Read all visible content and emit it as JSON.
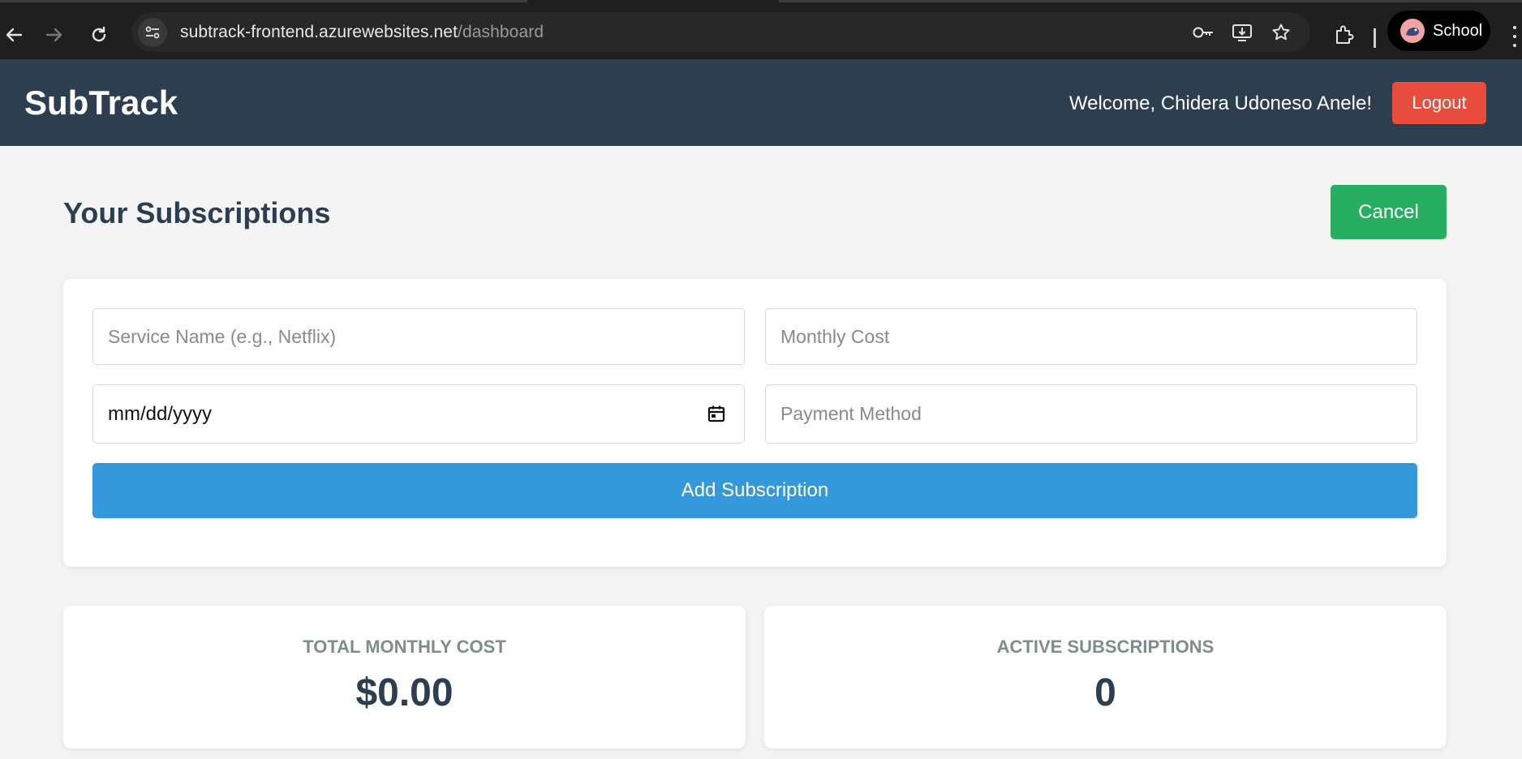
{
  "browser": {
    "url_host": "subtrack-frontend.azurewebsites.net",
    "url_path": "/dashboard",
    "profile_label": "School",
    "icons": [
      "back-icon",
      "forward-icon",
      "reload-icon",
      "site-info-icon",
      "password-key-icon",
      "install-app-icon",
      "bookmark-star-icon",
      "extensions-icon",
      "menu-icon"
    ]
  },
  "header": {
    "brand": "SubTrack",
    "welcome": "Welcome, Chidera Udoneso Anele!",
    "logout_label": "Logout"
  },
  "main": {
    "title": "Your Subscriptions",
    "cancel_label": "Cancel"
  },
  "form": {
    "service_placeholder": "Service Name (e.g., Netflix)",
    "cost_placeholder": "Monthly Cost",
    "date_value": "mm/dd/yyyy",
    "payment_placeholder": "Payment Method",
    "submit_label": "Add Subscription"
  },
  "stats": {
    "total_label": "TOTAL MONTHLY COST",
    "total_value": "$0.00",
    "active_label": "ACTIVE SUBSCRIPTIONS",
    "active_value": "0"
  },
  "colors": {
    "header_bg": "#2c3e50",
    "logout": "#e74c3c",
    "cancel": "#27ae60",
    "primary": "#3498db",
    "page_bg": "#f4f4f4"
  }
}
